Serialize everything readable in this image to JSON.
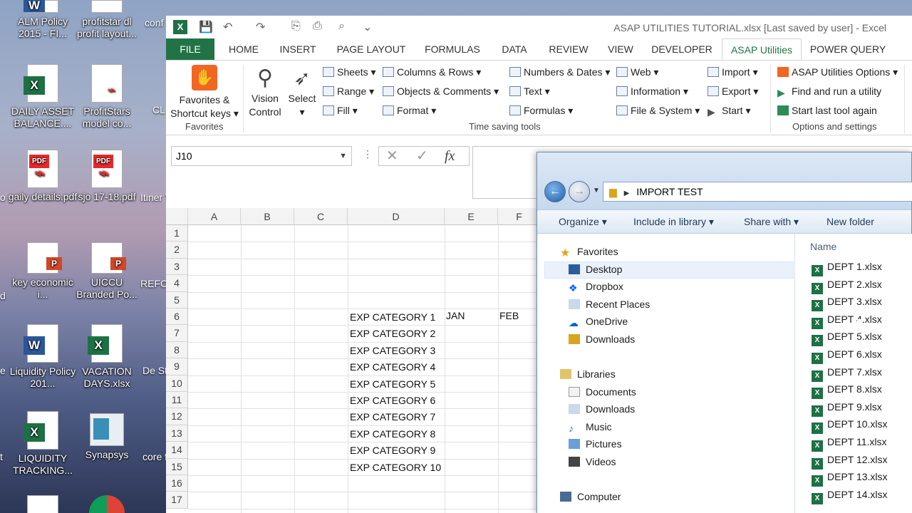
{
  "desktop": {
    "icons": [
      {
        "label": "ALM Policy 2015 - FI...",
        "badge": "W",
        "kind": "word"
      },
      {
        "label": "profitstar dl profit layout...",
        "badge": "",
        "kind": "pdf"
      },
      {
        "label": "DAILY ASSET BALANCE....",
        "badge": "X",
        "kind": "excel"
      },
      {
        "label": "ProfitStars model co...",
        "badge": "",
        "kind": "pdf"
      },
      {
        "label": "gaily details.pdf",
        "badge": "PDF",
        "kind": "pdf"
      },
      {
        "label": "sjo 17-18.pdf",
        "badge": "PDF",
        "kind": "pdf"
      },
      {
        "label": "key economic i...",
        "badge": "P",
        "kind": "ppt"
      },
      {
        "label": "UICCU Branded Po...",
        "badge": "P",
        "kind": "ppt"
      },
      {
        "label": "Liquidity Policy 201...",
        "badge": "W",
        "kind": "word"
      },
      {
        "label": "VACATION DAYS.xlsx",
        "badge": "X",
        "kind": "excel"
      },
      {
        "label": "LIQUIDITY TRACKING...",
        "badge": "X",
        "kind": "excel"
      },
      {
        "label": "Synapsys",
        "badge": "",
        "kind": "app"
      }
    ],
    "edge_labels": [
      "conf speec",
      "CL Th",
      "Itiner Veg",
      "REFO MEET",
      "De Strate",
      "core for p",
      "o",
      "d",
      "e",
      "t"
    ]
  },
  "excel": {
    "title": "ASAP UTILITIES TUTORIAL.xlsx [Last saved by user] - Excel",
    "tabs": [
      "FILE",
      "HOME",
      "INSERT",
      "PAGE LAYOUT",
      "FORMULAS",
      "DATA",
      "REVIEW",
      "VIEW",
      "DEVELOPER",
      "ASAP Utilities",
      "POWER QUERY"
    ],
    "active_tab": "ASAP Utilities",
    "ribbon": {
      "favorites_btn": "Favorites & Shortcut keys",
      "favorites_group": "Favorites",
      "vision_btn": "Vision Control",
      "select_btn": "Select",
      "col1": [
        "Sheets",
        "Range",
        "Fill"
      ],
      "col2": [
        "Columns & Rows",
        "Objects & Comments",
        "Format"
      ],
      "col3": [
        "Numbers & Dates",
        "Text",
        "Formulas"
      ],
      "col4": [
        "Web",
        "Information",
        "File & System"
      ],
      "col5": [
        "Import",
        "Export",
        "Start"
      ],
      "time_group": "Time saving tools",
      "col6": [
        "ASAP Utilities Options",
        "Find and run a utility",
        "Start last tool again"
      ],
      "options_group": "Options and settings"
    },
    "name_box": "J10",
    "columns": [
      "A",
      "B",
      "C",
      "D",
      "E",
      "F"
    ],
    "rows": [
      "1",
      "2",
      "3",
      "4",
      "5",
      "6",
      "7",
      "8",
      "9",
      "10",
      "11",
      "12",
      "13",
      "14",
      "15",
      "16",
      "17"
    ],
    "headers_row5": {
      "E": "JAN",
      "F": "FEB"
    },
    "categories": [
      "EXP CATEGORY 1",
      "EXP CATEGORY 2",
      "EXP CATEGORY 3",
      "EXP CATEGORY 4",
      "EXP CATEGORY 5",
      "EXP CATEGORY 6",
      "EXP CATEGORY 7",
      "EXP CATEGORY 8",
      "EXP CATEGORY 9",
      "EXP CATEGORY 10"
    ]
  },
  "explorer": {
    "path": "IMPORT TEST",
    "commands": [
      "Organize",
      "Include in library",
      "Share with",
      "New folder"
    ],
    "column_header": "Name",
    "favorites_label": "Favorites",
    "favorites": [
      "Desktop",
      "Dropbox",
      "Recent Places",
      "OneDrive",
      "Downloads"
    ],
    "selected_favorite": "Desktop",
    "libraries_label": "Libraries",
    "libraries": [
      "Documents",
      "Downloads",
      "Music",
      "Pictures",
      "Videos"
    ],
    "computer_label": "Computer",
    "files": [
      "DEPT 1.xlsx",
      "DEPT 2.xlsx",
      "DEPT 3.xlsx",
      "DEPT 4.xlsx",
      "DEPT 5.xlsx",
      "DEPT 6.xlsx",
      "DEPT 7.xlsx",
      "DEPT 8.xlsx",
      "DEPT 9.xlsx",
      "DEPT 10.xlsx",
      "DEPT 11.xlsx",
      "DEPT 12.xlsx",
      "DEPT 13.xlsx",
      "DEPT 14.xlsx"
    ],
    "hovered_file": "DEPT 4.xlsx"
  },
  "colors": {
    "excel_green": "#217346",
    "explorer_blue": "#dce8f5"
  }
}
